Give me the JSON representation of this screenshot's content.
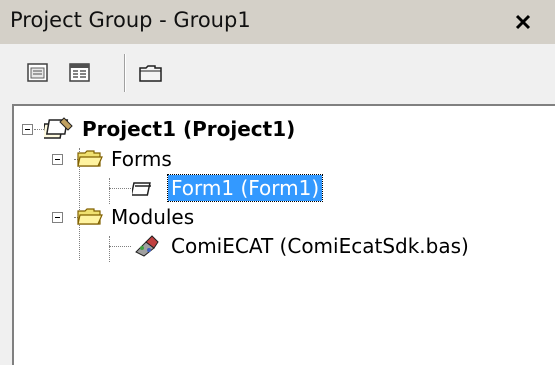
{
  "window": {
    "title": "Project Group - Group1",
    "close_glyph": "✕"
  },
  "toolbar": {
    "buttons": [
      {
        "name": "view-object-button",
        "icon": "view-object-icon"
      },
      {
        "name": "view-code-button",
        "icon": "view-code-icon"
      },
      {
        "name": "toggle-folders-button",
        "icon": "folder-icon"
      }
    ]
  },
  "tree": {
    "project": {
      "label": "Project1 (Project1)",
      "icon": "project-icon"
    },
    "forms_folder": {
      "label": "Forms",
      "icon": "folder-open-icon"
    },
    "form1": {
      "label": "Form1 (Form1)",
      "icon": "form-icon",
      "selected": true
    },
    "modules_folder": {
      "label": "Modules",
      "icon": "folder-open-icon"
    },
    "module1": {
      "label": "ComiECAT (ComiEcatSdk.bas)",
      "icon": "module-icon"
    }
  },
  "colors": {
    "selection": "#3399ff",
    "titlebar": "#d4d0c8"
  }
}
